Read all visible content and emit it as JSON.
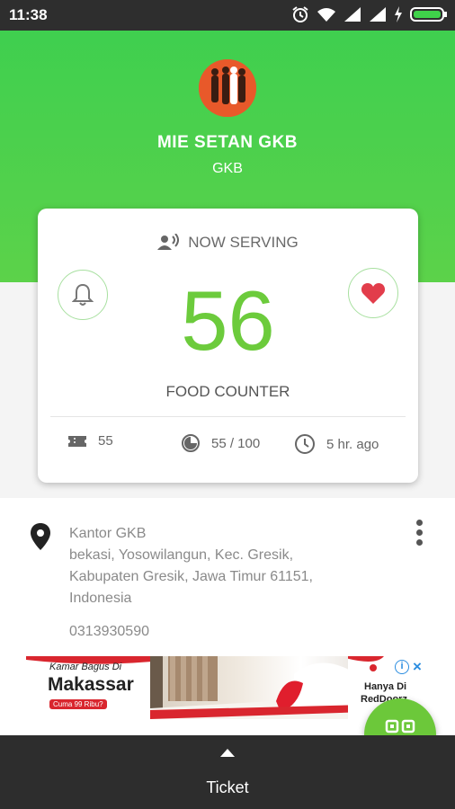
{
  "status_bar": {
    "time": "11:38"
  },
  "shop": {
    "name": "MIE SETAN GKB",
    "subtitle": "GKB"
  },
  "card": {
    "serving_label": "NOW SERVING",
    "number": "56",
    "counter_label": "FOOD COUNTER",
    "ticket_count": "55",
    "progress": "55 / 100",
    "time_ago": "5 hr. ago"
  },
  "location": {
    "name": "Kantor GKB",
    "address_line1": "bekasi, Yosowilangun, Kec. Gresik,",
    "address_line2": "Kabupaten Gresik, Jawa Timur 61151,",
    "address_line3": "Indonesia",
    "phone": "0313930590"
  },
  "ad": {
    "headline": "Kamar Bagus Di",
    "city": "Makassar",
    "price": "Cuma 99 Ribu?",
    "right_line1": "Hanya Di",
    "right_line2": "RedDoorz."
  },
  "bottom_bar": {
    "label": "Ticket"
  },
  "colors": {
    "accent": "#6ccb3c",
    "header": "#4ccf4a",
    "heart": "#e23d4b"
  }
}
